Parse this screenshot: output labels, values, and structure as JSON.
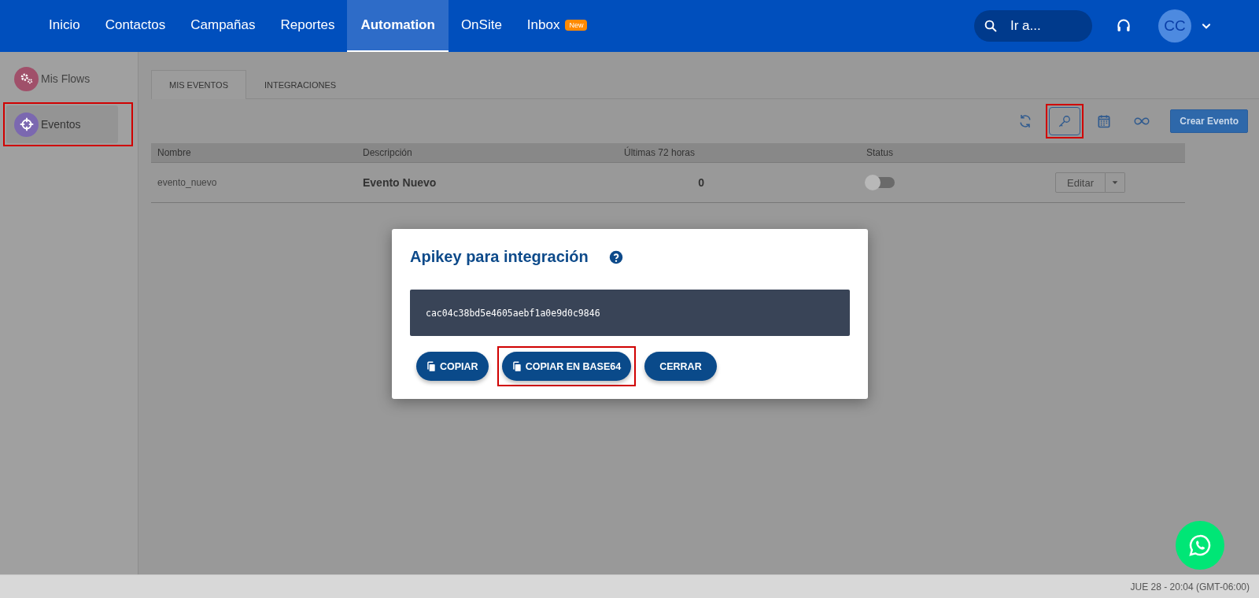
{
  "nav": {
    "items": [
      {
        "label": "Inicio",
        "selected": false
      },
      {
        "label": "Contactos",
        "selected": false
      },
      {
        "label": "Campañas",
        "selected": false
      },
      {
        "label": "Reportes",
        "selected": false
      },
      {
        "label": "Automation",
        "selected": true
      },
      {
        "label": "OnSite",
        "selected": false
      },
      {
        "label": "Inbox",
        "selected": false,
        "badge": "New"
      }
    ],
    "search": {
      "placeholder": "Ir a..."
    },
    "avatar": "CC"
  },
  "sidebar": {
    "items": [
      {
        "label": "Mis Flows",
        "kind": "flows",
        "color": "#a0506a",
        "selected": false,
        "highlighted": false
      },
      {
        "label": "Eventos",
        "kind": "events",
        "color": "#7b68b0",
        "selected": true,
        "highlighted": true
      }
    ]
  },
  "tabs": [
    {
      "label": "MIS EVENTOS",
      "selected": true
    },
    {
      "label": "INTEGRACIONES",
      "selected": false
    }
  ],
  "toolbar": {
    "tools": [
      {
        "kind": "refresh",
        "highlighted": false
      },
      {
        "kind": "key",
        "highlighted": true
      },
      {
        "kind": "calendar",
        "highlighted": false
      },
      {
        "kind": "infinity",
        "highlighted": false
      }
    ],
    "create_button": "Crear Evento"
  },
  "table": {
    "columns": [
      "Nombre",
      "Descripción",
      "Últimas 72 horas",
      "Status"
    ],
    "rows": [
      {
        "nombre": "evento_nuevo",
        "descripcion": "Evento Nuevo",
        "ultimas": "0",
        "status_on": false,
        "action": "Editar"
      }
    ]
  },
  "modal": {
    "title": "Apikey para integración",
    "apikey": "cac04c38bd5e4605aebf1a0e9d0c9846",
    "buttons": [
      {
        "label": "COPIAR",
        "kind": "copy",
        "highlighted": false
      },
      {
        "label": "COPIAR EN BASE64",
        "kind": "copy",
        "highlighted": true
      },
      {
        "label": "CERRAR",
        "kind": "plain",
        "highlighted": false
      }
    ]
  },
  "status_bar": "JUE 28 - 20:04 (GMT-06:00)"
}
